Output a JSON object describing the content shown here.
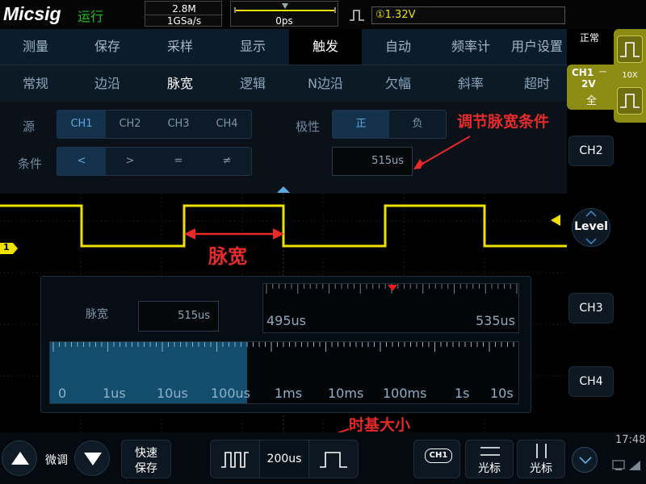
{
  "topbar": {
    "brand": "Micsig",
    "run_state": "运行",
    "memory_depth": "2.8M",
    "sample_rate": "1GSa/s",
    "horizontal_position": "0ps",
    "trigger_level": "①1.32V"
  },
  "menu_main": {
    "items": [
      "测量",
      "保存",
      "采样",
      "显示",
      "触发",
      "自动",
      "频率计",
      "用户设置"
    ],
    "active": "触发"
  },
  "menu_trigger": {
    "items": [
      "常规",
      "边沿",
      "脉宽",
      "逻辑",
      "N边沿",
      "欠幅",
      "斜率",
      "超时"
    ],
    "active": "脉宽"
  },
  "trigger_panel": {
    "source_label": "源",
    "sources": [
      "CH1",
      "CH2",
      "CH3",
      "CH4"
    ],
    "source_selected": "CH1",
    "condition_label": "条件",
    "conditions": [
      "<",
      ">",
      "=",
      "≠"
    ],
    "condition_selected": "<",
    "polarity_label": "极性",
    "polarities": [
      "正",
      "负"
    ],
    "polarity_selected": "正",
    "width_value": "515us"
  },
  "annotations": {
    "adjust_width": "调节脉宽条件",
    "pulse_width": "脉宽",
    "timebase": "时基大小"
  },
  "waveform": {
    "channel_marker": "1",
    "high_segments": [
      [
        228,
        351
      ],
      [
        477,
        600
      ]
    ],
    "trace_color": "#f0e000"
  },
  "pulse_width_panel": {
    "label": "脉宽",
    "value": "515us",
    "fine_scale_min": "495us",
    "fine_scale_max": "535us",
    "coarse_scale_labels": [
      "0",
      "1us",
      "10us",
      "100us",
      "1ms",
      "10ms",
      "100ms",
      "1s",
      "10s"
    ],
    "coarse_fill_fraction": 0.42
  },
  "right_column": {
    "status": "正常",
    "ch1_label": "CH1",
    "ch1_scale": "2V",
    "ch1_coupling": "全",
    "probe": "10X",
    "ch2": "CH2",
    "level": "Level",
    "ch3": "CH3",
    "ch4": "CH4",
    "time": "17:48"
  },
  "bottombar": {
    "fine_label": "微调",
    "quick_save_line1": "快速",
    "quick_save_line2": "保存",
    "timebase": "200us",
    "ch1_icon_label": "CH1",
    "cursor_h": "光标",
    "cursor_v": "光标"
  },
  "colors": {
    "accent_blue": "#5ca8e0",
    "trace_yellow": "#f0e000",
    "run_green": "#1ec21e",
    "annotation_red": "#e52a2a",
    "ch1_badge": "#8c8c14"
  }
}
